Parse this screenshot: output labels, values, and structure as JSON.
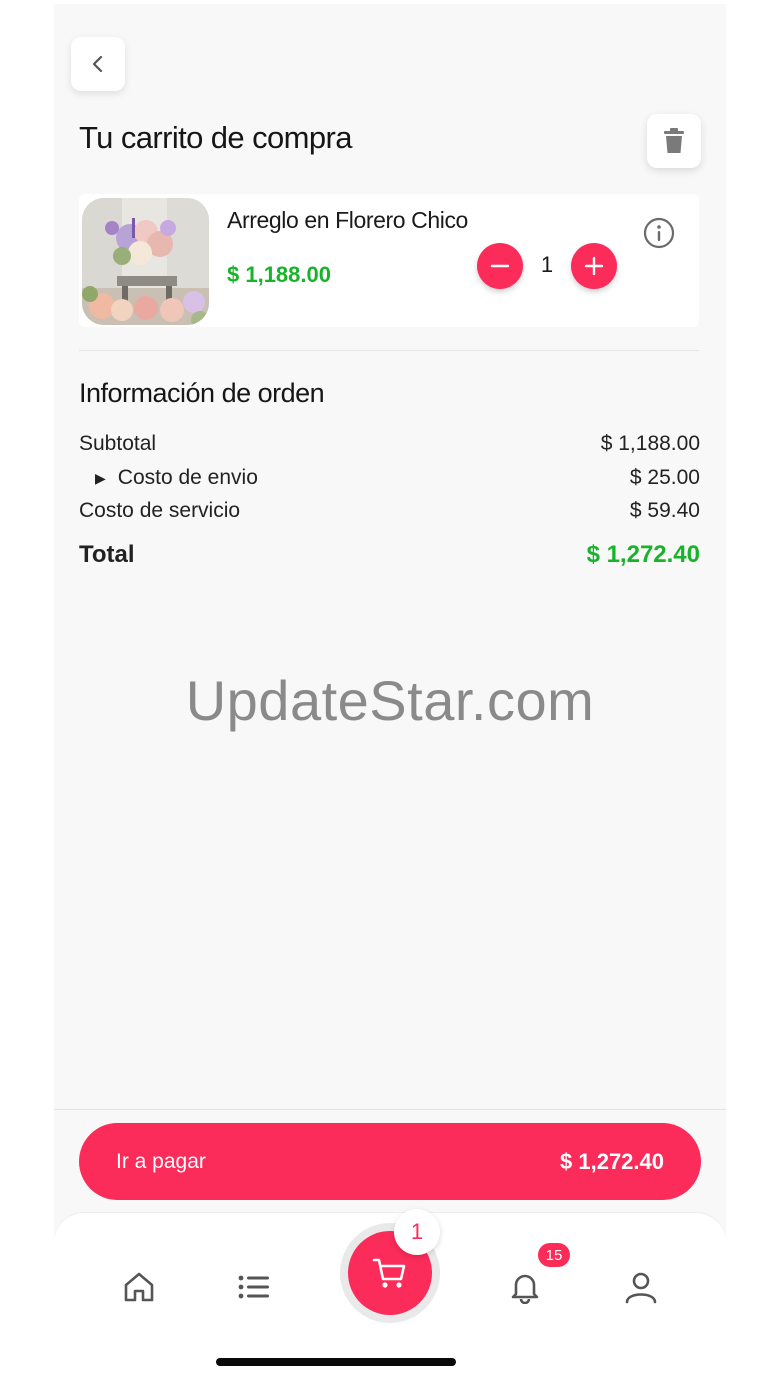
{
  "header": {
    "title": "Tu carrito de compra",
    "back_icon": "chevron-left-icon",
    "delete_icon": "trash-icon"
  },
  "cart_item": {
    "name": "Arreglo en Florero Chico",
    "price": "$ 1,188.00",
    "quantity": "1",
    "image": "flower-arrangement-photo"
  },
  "order_info": {
    "title": "Información de orden",
    "rows": [
      {
        "label": "Subtotal",
        "value": "$ 1,188.00"
      },
      {
        "label": "Costo de envio",
        "value": "$ 25.00"
      },
      {
        "label": "Costo de servicio",
        "value": "$ 59.40"
      }
    ],
    "total_label": "Total",
    "total_value": "$ 1,272.40"
  },
  "watermark": "UpdateStar.com",
  "checkout": {
    "label": "Ir a pagar",
    "amount": "$ 1,272.40"
  },
  "tabbar": {
    "cart_count": "1",
    "notifications_count": "15"
  },
  "colors": {
    "accent": "#fb2c5a",
    "price_green": "#19b32b"
  }
}
